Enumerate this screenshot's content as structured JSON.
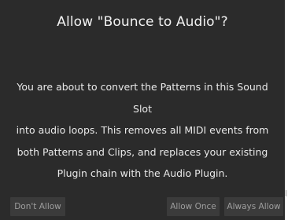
{
  "dialog": {
    "title": "Allow \"Bounce to Audio\"?",
    "message_lines": [
      "You are about to convert the Patterns in this Sound Slot",
      "into audio loops. This removes all MIDI events from",
      "both Patterns and Clips, and replaces your existing",
      "Plugin chain with the Audio Plugin."
    ],
    "buttons": {
      "dont_allow": "Don't Allow",
      "allow_once": "Allow Once",
      "always_allow": "Always Allow"
    }
  },
  "colors": {
    "dialog_bg": "#2b2b2b",
    "title_text": "#f2f2f2",
    "body_text": "#e9e9e9",
    "button_bg": "#3b3b3b",
    "button_text": "#9e9e9e"
  }
}
